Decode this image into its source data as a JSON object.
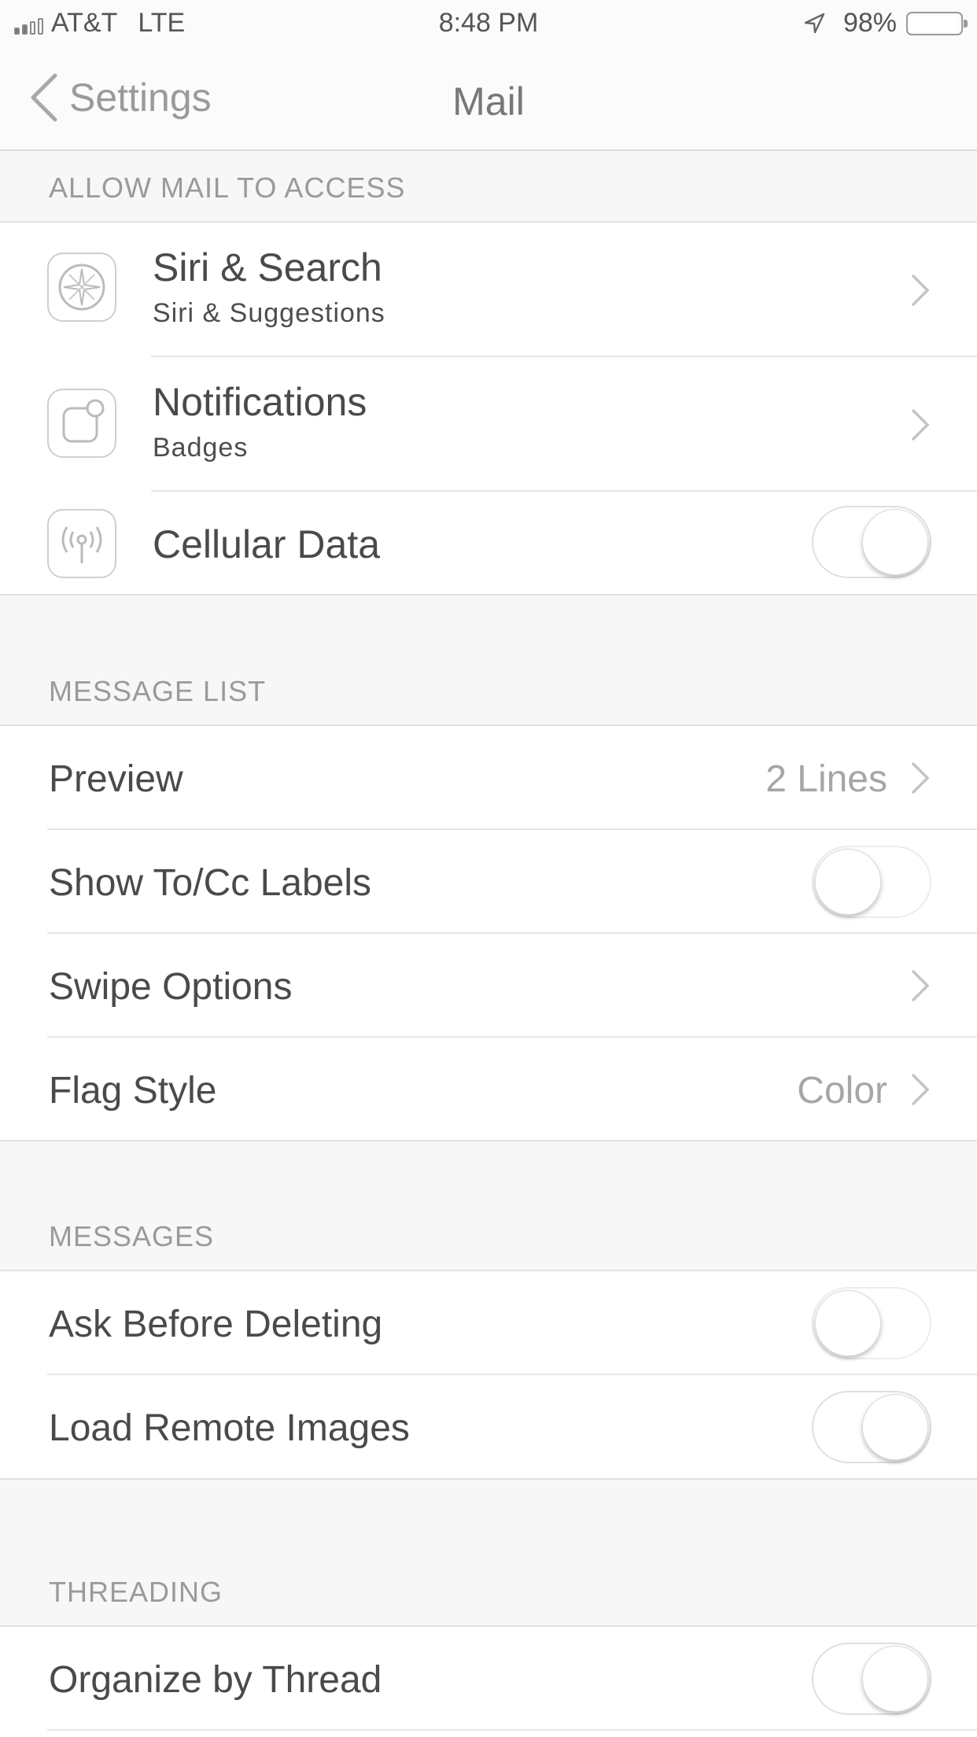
{
  "status_bar": {
    "carrier": "AT&T",
    "network": "LTE",
    "time": "8:48 PM",
    "battery": "98%",
    "signal_bars_filled": 2,
    "signal_bars_total": 4
  },
  "nav": {
    "back_label": "Settings",
    "title": "Mail"
  },
  "sections": {
    "allow": {
      "header": "ALLOW MAIL TO ACCESS",
      "siri_title": "Siri & Search",
      "siri_subtitle": "Siri & Suggestions",
      "notif_title": "Notifications",
      "notif_subtitle": "Badges",
      "cellular_title": "Cellular Data",
      "cellular_on": true
    },
    "message_list": {
      "header": "MESSAGE LIST",
      "preview_label": "Preview",
      "preview_value": "2 Lines",
      "tocc_label": "Show To/Cc Labels",
      "tocc_on": false,
      "swipe_label": "Swipe Options",
      "flag_label": "Flag Style",
      "flag_value": "Color"
    },
    "messages": {
      "header": "MESSAGES",
      "ask_label": "Ask Before Deleting",
      "ask_on": false,
      "load_label": "Load Remote Images",
      "load_on": true
    },
    "threading": {
      "header": "THREADING",
      "organize_label": "Organize by Thread",
      "organize_on": true
    }
  },
  "icons": {
    "back": "chevron-left-icon",
    "chevron": "chevron-right-icon",
    "location": "location-arrow-icon",
    "battery": "battery-icon",
    "siri": "siri-icon",
    "notifications": "notifications-icon",
    "cellular": "cellular-antenna-icon"
  }
}
